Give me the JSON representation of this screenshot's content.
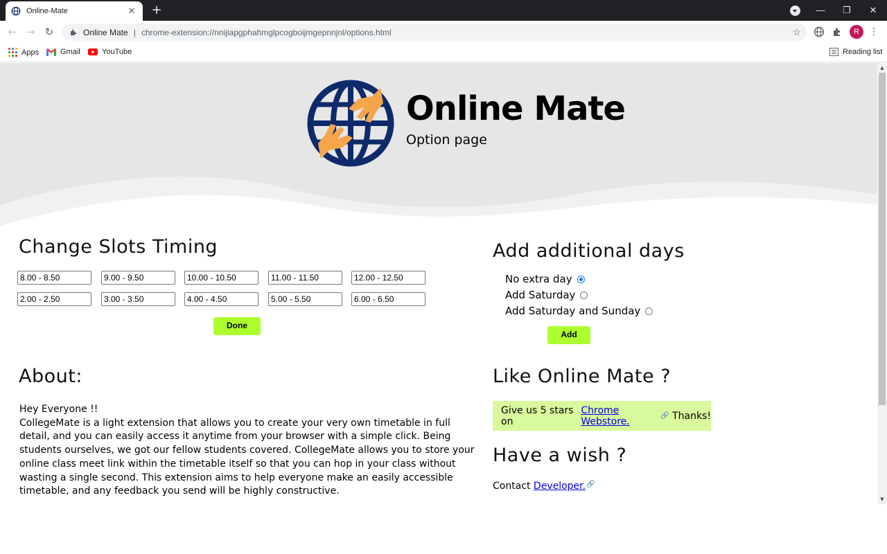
{
  "browser": {
    "tab_title": "Online-Mate",
    "site_name": "Online Mate",
    "url": "chrome-extension://nnijiapgphahmglpcogboijmgepnnjnl/options.html",
    "avatar_letter": "R",
    "bookmarks": [
      {
        "label": "Apps",
        "icon": "apps-grid-icon"
      },
      {
        "label": "Gmail",
        "icon": "gmail-icon"
      },
      {
        "label": "YouTube",
        "icon": "youtube-icon"
      }
    ],
    "reading_list_label": "Reading list"
  },
  "header": {
    "title": "Online Mate",
    "subtitle": "Option page",
    "logo_icon": "globe-hands-logo"
  },
  "slots": {
    "heading": "Change Slots Timing",
    "values": [
      "8.00 - 8.50",
      "9.00 - 9.50",
      "10.00 - 10.50",
      "11.00 - 11.50",
      "12.00 - 12.50",
      "2.00 - 2.50",
      "3.00 - 3.50",
      "4.00 - 4.50",
      "5.00 - 5.50",
      "6.00 - 6.50"
    ],
    "done_label": "Done"
  },
  "days": {
    "heading": "Add additional days",
    "options": [
      "No extra day",
      "Add Saturday",
      "Add Saturday and Sunday"
    ],
    "selected_index": 0,
    "add_label": "Add"
  },
  "about": {
    "heading": "About:",
    "greeting": "Hey Everyone !!",
    "body": "CollegeMate is a light extension that allows you to create your very own timetable in full detail, and you can easily access it anytime from your browser with a simple click. Being students ourselves, we got our fellow students covered. CollegeMate allows you to store your online class meet link within the timetable itself so that you can hop in your class without wasting a single second. This extension aims to help everyone make an easily accessible timetable, and any feedback you send will be highly constructive."
  },
  "like": {
    "heading": "Like Online Mate ?",
    "prefix": "Give us 5 stars on",
    "link": "Chrome Webstore.",
    "suffix": "Thanks!"
  },
  "wish": {
    "heading": "Have a wish ?",
    "prefix": "Contact",
    "link": "Developer."
  },
  "colors": {
    "button_accent": "#adff2f",
    "rate_box_bg": "#d9f99d",
    "logo_navy": "#0f2a6b",
    "logo_orange": "#f5a54a",
    "hero_bg": "#e6e6e6"
  }
}
